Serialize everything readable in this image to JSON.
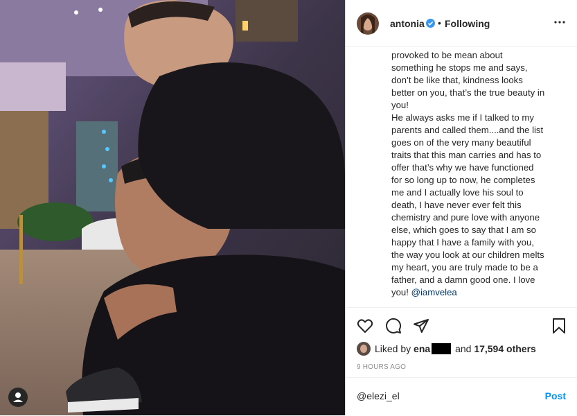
{
  "header": {
    "username": "antonia",
    "separator": "•",
    "follow_status": "Following",
    "verified_icon": "verified-badge-icon",
    "more_icon": "more-options-icon"
  },
  "caption": {
    "text": "provoked to be mean about\nsomething he stops me and says,\ndon’t be like that, kindness looks\nbetter on you, that’s the true beauty in\nyou!\nHe always asks me if I talked to my\nparents and called them....and the list\ngoes on of the very many beautiful\ntraits that this man carries and has to\noffer that’s why we have functioned\nfor so long up to now, he completes\nme and I actually love his soul to\ndeath, I have never ever felt this\nchemistry and pure love with anyone\nelse, which goes to say that I am so\nhappy that I have a family with you,\nthe way you look at our children melts\nmy heart, you are truly made to be a\nfather, and a damn good one. I love\nyou! ",
    "mention": "@iamvelea"
  },
  "actions": {
    "like_icon": "heart-icon",
    "comment_icon": "comment-icon",
    "share_icon": "share-icon",
    "save_icon": "bookmark-icon"
  },
  "likes": {
    "prefix": "Liked by",
    "user_visible": "ena",
    "and_text": "and",
    "count_text": "17,594 others"
  },
  "timestamp": "9 HOURS AGO",
  "comment_box": {
    "value": "@elezi_el",
    "post_label": "Post"
  },
  "colors": {
    "link": "#00376b",
    "post_button": "#0095f6",
    "verified": "#3897f0"
  }
}
